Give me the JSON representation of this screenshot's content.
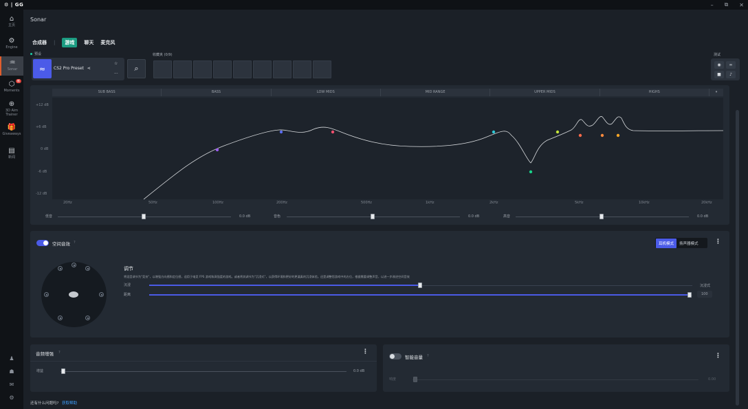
{
  "titlebar": {
    "logo": "⚙ | GG",
    "minimize": "–",
    "restore": "⧉",
    "close": "✕"
  },
  "sidebar": {
    "items": [
      {
        "label": "主页",
        "icon": "home-icon",
        "glyph": "⌂"
      },
      {
        "label": "Engine",
        "icon": "gear-icon",
        "glyph": "⚙"
      },
      {
        "label": "Sonar",
        "icon": "sonar-icon",
        "glyph": "♒"
      },
      {
        "label": "Moments",
        "icon": "moments-icon",
        "glyph": "⬡",
        "badge": "新"
      },
      {
        "label": "3D Aim Trainer",
        "icon": "crosshair-icon",
        "glyph": "⊕"
      },
      {
        "label": "Giveaways",
        "icon": "gift-icon",
        "glyph": "🎁"
      },
      {
        "label": "新闻",
        "icon": "news-icon",
        "glyph": "▤"
      }
    ],
    "bottom": [
      {
        "icon": "user-icon",
        "glyph": "♟"
      },
      {
        "icon": "friends-icon",
        "glyph": "☗"
      },
      {
        "icon": "feedback-icon",
        "glyph": "✉"
      },
      {
        "icon": "settings-icon",
        "glyph": "⚙"
      }
    ]
  },
  "app_title": "Sonar",
  "tabs": [
    "合成器",
    "游戏",
    "聊天",
    "麦克风"
  ],
  "tabs_separator": "|",
  "preset": {
    "section_label": "预设",
    "name": "CS2 Pro Preset",
    "share": "⋖"
  },
  "favorites": {
    "label": "收藏夹 (0/9)",
    "slots": 9
  },
  "test": {
    "label": "测试"
  },
  "eq": {
    "bands": [
      "SUB BASS",
      "BASS",
      "LOW MIDS",
      "MID RANGE",
      "UPPER MIDS",
      "HIGHS"
    ],
    "db_labels": [
      "+12 dB",
      "+6 dB",
      "0 dB",
      "-6 dB",
      "-12 dB"
    ],
    "freq_labels": [
      "20Hz",
      "50Hz",
      "100Hz",
      "200Hz",
      "500Hz",
      "1kHz",
      "2kHz",
      "5kHz",
      "10kHz",
      "20kHz"
    ],
    "colors": {
      "curve": "#d9dcdf",
      "points": [
        "#9b5cf0",
        "#5a6cf0",
        "#f0506e",
        "#2ec9d6",
        "#19d28a",
        "#c5e63a",
        "#ff6b4a",
        "#ff8a3d",
        "#ffa726"
      ]
    },
    "sliders": [
      {
        "label": "低音",
        "value": "0.0 dB"
      },
      {
        "label": "音色",
        "value": "0.0 dB"
      },
      {
        "label": "高音",
        "value": "0.0 dB"
      }
    ]
  },
  "spatial": {
    "title": "空间音效",
    "help": "?",
    "modes": [
      "耳机模式",
      "扬声器模式"
    ],
    "section_title": "调节",
    "description": "将混音调节为\"竞技\"，以增强方向感和定位感，适用于电竞 FPS 游戏和高强度的游戏。或者将其调节为\"沉浸式\"，以获得环境和更好的更逼真的沉浸体验。还是调整您游戏中的方位，根据需要调整声音，以进一步改进空间音效",
    "sliders": [
      {
        "label": "沉浸",
        "value": "沉浸式"
      },
      {
        "label": "距离",
        "value": "100"
      }
    ]
  },
  "enhancer": {
    "title": "音频增强",
    "help": "?",
    "slider_label": "增益",
    "value": "0.0 dB"
  },
  "smart_volume": {
    "title": "智能音量",
    "help": "?",
    "slider_label": "响度",
    "value": "0.00"
  },
  "footer": {
    "question": "还有什么问题吗?",
    "link": "获取帮助"
  }
}
